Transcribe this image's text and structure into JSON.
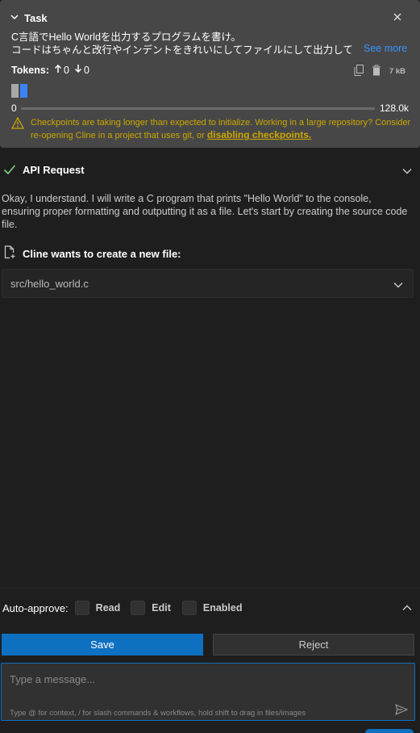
{
  "task": {
    "title": "Task",
    "line1": "C言語でHello Worldを出力するプログラムを書け。",
    "line2": "コードはちゃんと改行やインデントをきれいにしてファイルにして出力して",
    "see_more": "See more",
    "tokens_label": "Tokens:",
    "tokens_up": "0",
    "tokens_down": "0",
    "size": "7 kB",
    "context_min": "0",
    "context_max": "128.0k",
    "context_used_fraction": 0.0,
    "warning_text": "Checkpoints are taking longer than expected to initialize. Working in a large repository? Consider re-opening Cline in a project that uses git, or ",
    "warning_link": "disabling checkpoints."
  },
  "api_request": {
    "title": "API Request",
    "status": "success"
  },
  "message": "Okay, I understand. I will write a C program that prints \"Hello World\" to the console, ensuring proper formatting and outputting it as a file. Let's start by creating the source code file.",
  "new_file": {
    "title": "Cline wants to create a new file:",
    "path": "src/hello_world.c"
  },
  "auto_approve": {
    "label": "Auto-approve:",
    "options": [
      {
        "label": "Read",
        "checked": false
      },
      {
        "label": "Edit",
        "checked": false
      },
      {
        "label": "Enabled",
        "checked": false
      }
    ]
  },
  "buttons": {
    "save": "Save",
    "reject": "Reject"
  },
  "chat_input": {
    "placeholder": "Type a message...",
    "hint": "Type @ for context, / for slash commands & workflows, hold shift to drag in files/images"
  },
  "colors": {
    "accent": "#0e70c0",
    "warning": "#cca700",
    "success": "#89d185",
    "link": "#3794ff"
  }
}
